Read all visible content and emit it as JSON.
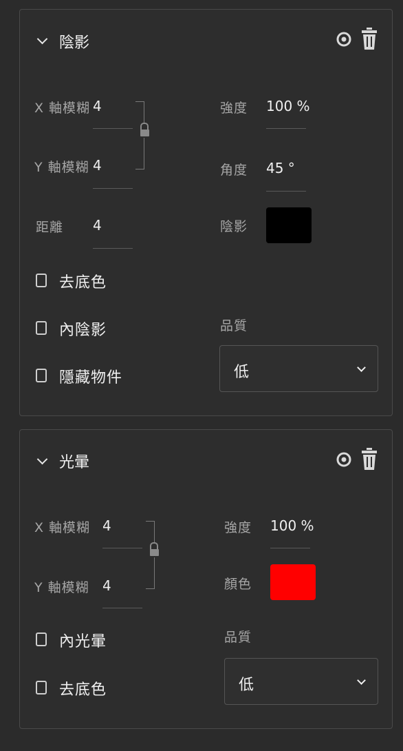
{
  "shadow": {
    "title": "陰影",
    "x_blur_label": "X 軸模糊",
    "x_blur_value": "4",
    "y_blur_label": "Y 軸模糊",
    "y_blur_value": "4",
    "distance_label": "距離",
    "distance_value": "4",
    "strength_label": "強度",
    "strength_value": "100 %",
    "angle_label": "角度",
    "angle_value": "45 °",
    "color_label": "陰影",
    "color_hex": "#000000",
    "checkbox_remove_bg": "去底色",
    "checkbox_inner_shadow": "內陰影",
    "checkbox_hide_object": "隱藏物件",
    "quality_label": "品質",
    "quality_value": "低"
  },
  "glow": {
    "title": "光暈",
    "x_blur_label": "X 軸模糊",
    "x_blur_value": "4",
    "y_blur_label": "Y 軸模糊",
    "y_blur_value": "4",
    "strength_label": "強度",
    "strength_value": "100 %",
    "color_label": "顏色",
    "color_hex": "#ff0000",
    "checkbox_inner_glow": "內光暈",
    "checkbox_remove_bg": "去底色",
    "quality_label": "品質",
    "quality_value": "低"
  },
  "icons": {
    "collapse": "chevron-down-icon",
    "visibility": "eye-icon",
    "delete": "trash-icon",
    "link": "unlock-icon",
    "dropdown": "chevron-down-icon"
  }
}
